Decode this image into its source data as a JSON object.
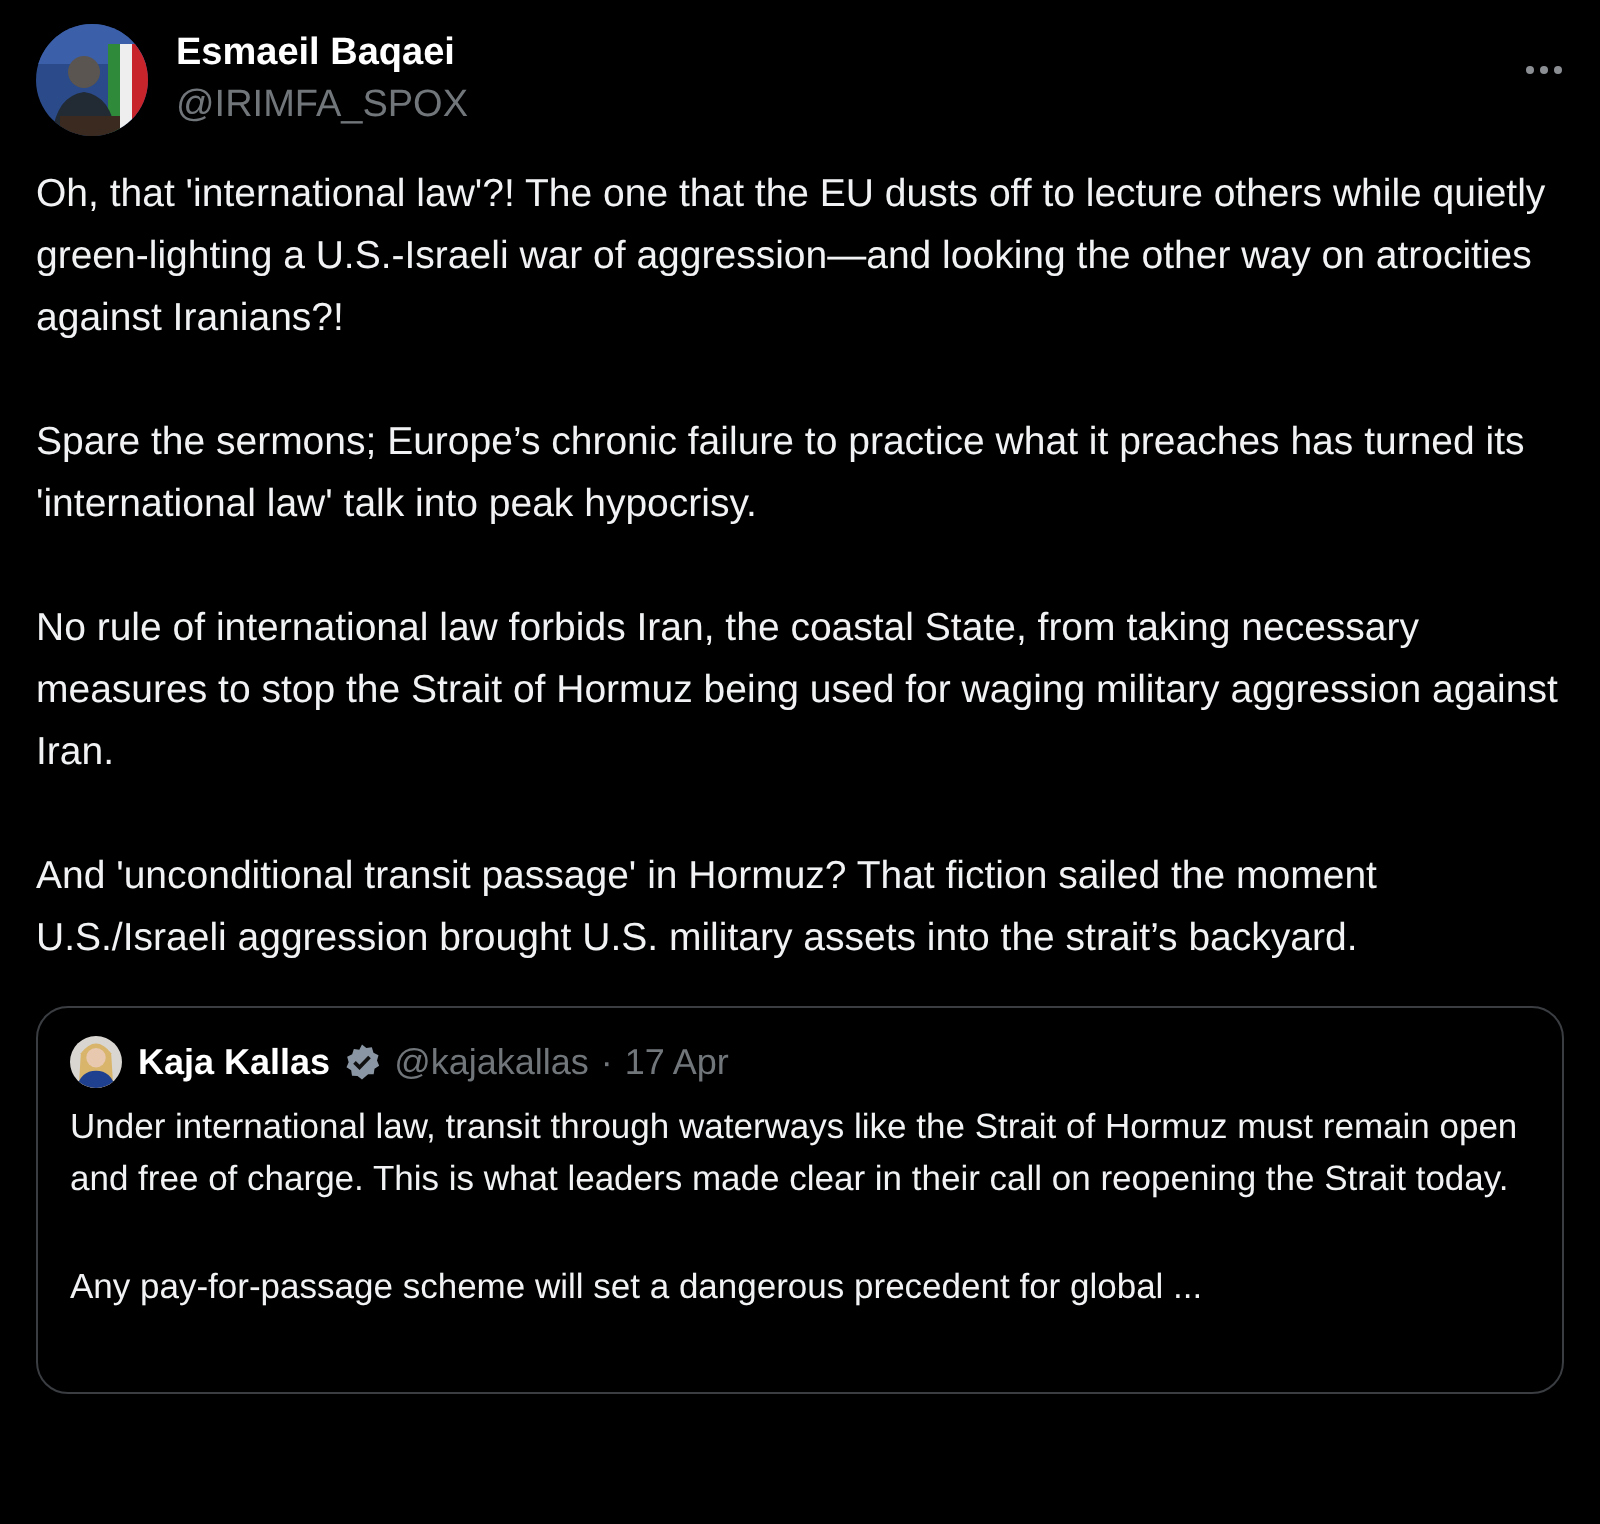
{
  "post": {
    "author": {
      "name": "Esmaeil Baqaei",
      "handle": "@IRIMFA_SPOX"
    },
    "paragraphs": [
      "Oh, that 'international law'?! The one that the EU dusts off to lecture others while quietly green-lighting a U.S.-Israeli war of aggression—and looking the other way on atrocities against Iranians?!",
      "Spare the sermons; Europe’s chronic failure to practice what it preaches has turned its 'international law' talk into peak hypocrisy.",
      "No rule of international law forbids Iran, the coastal State, from taking necessary measures to stop the Strait of Hormuz being used for waging military aggression against Iran.",
      "And 'unconditional transit passage' in Hormuz? That fiction sailed the moment U.S./Israeli aggression brought U.S. military assets into the strait’s backyard."
    ]
  },
  "quoted_post": {
    "author": {
      "name": "Kaja Kallas",
      "verified": true,
      "handle": "@kajakallas"
    },
    "separator": "·",
    "date": "17 Apr",
    "paragraphs": [
      "Under international law, transit through waterways like the Strait of Hormuz must remain open and free of charge. This is what leaders made clear in their call on reopening the Strait today.",
      "Any pay-for-passage scheme will set a dangerous precedent for global ..."
    ]
  }
}
